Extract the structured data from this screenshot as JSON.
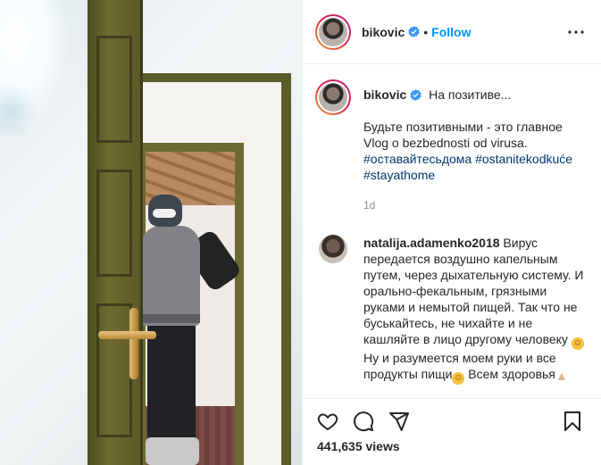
{
  "header": {
    "username": "bikovic",
    "separator": "•",
    "follow_label": "Follow",
    "more_icon": "more-horizontal-icon"
  },
  "caption": {
    "username": "bikovic",
    "headline": "На позитиве...",
    "text_line1": "Будьте позитивными - это главное",
    "text_line2": "Vlog o bezbednosti od virusa.",
    "hashtags": [
      "#оставайтесьдома",
      "#ostanitekodkuće",
      "#stayathome"
    ],
    "age": "1d"
  },
  "comment": {
    "username": "natalija.adamenko2018",
    "text1": "Вирус передается воздушно капельным путем, через дыхательную систему. И орально-фекальным, грязными руками и немытой пищей. Так что не буськайтесь, не чихайте и не кашляйте в лицо другому человеку",
    "text2": "Ну и разумеется моем руки и все продукты пищи",
    "text3": "Всем здоровья",
    "emoji1": "grinning-face",
    "emoji2": "winking-face",
    "emoji3": "folded-hands"
  },
  "actions": {
    "like_icon": "heart-icon",
    "comment_icon": "comment-icon",
    "share_icon": "paper-plane-icon",
    "save_icon": "bookmark-icon"
  },
  "stats": {
    "views": "441,635 views"
  },
  "colors": {
    "link": "#0095f6",
    "hashtag": "#00376b",
    "muted": "#8e8e8e",
    "verified": "#3897f0"
  }
}
